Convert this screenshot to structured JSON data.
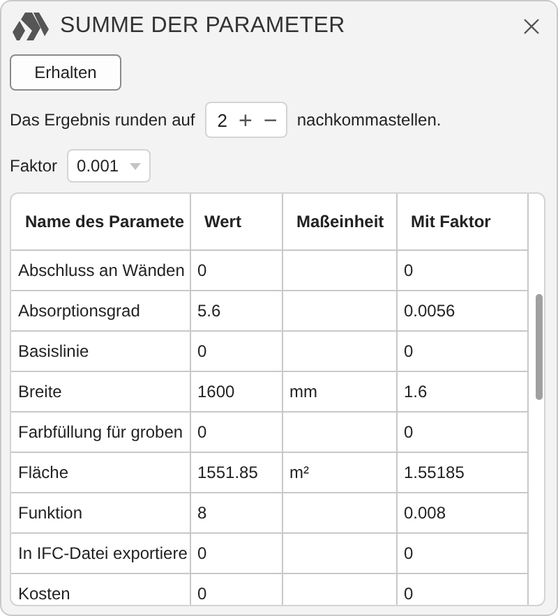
{
  "window": {
    "title": "SUMME DER PARAMETER"
  },
  "get_button": {
    "label": "Erhalten"
  },
  "rounding": {
    "prefix": "Das Ergebnis runden auf",
    "value": "2",
    "plus": "+",
    "minus": "−",
    "suffix": "nachkommastellen."
  },
  "factor": {
    "label": "Faktor",
    "value": "0.001"
  },
  "table": {
    "columns": [
      "Name des Paramete",
      "Wert",
      "Maßeinheit",
      "Mit Faktor"
    ],
    "rows": [
      [
        "Abschluss an Wänden",
        "0",
        "",
        "0"
      ],
      [
        "Absorptionsgrad",
        "5.6",
        "",
        "0.0056"
      ],
      [
        "Basislinie",
        "0",
        "",
        "0"
      ],
      [
        "Breite",
        "1600",
        "mm",
        "1.6"
      ],
      [
        "Farbfüllung für groben",
        "0",
        "",
        "0"
      ],
      [
        "Fläche",
        "1551.85",
        "m²",
        "1.55185"
      ],
      [
        "Funktion",
        "8",
        "",
        "0.008"
      ],
      [
        "In IFC-Datei exportiere",
        "0",
        "",
        "0"
      ],
      [
        "Kosten",
        "0",
        "",
        "0"
      ]
    ]
  }
}
